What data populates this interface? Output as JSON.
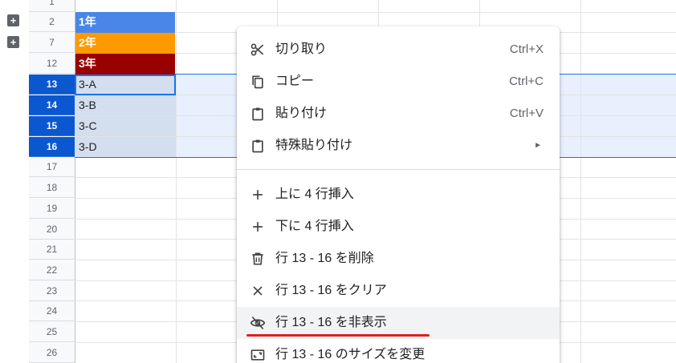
{
  "row_headers": [
    "1",
    "2",
    "7",
    "12",
    "13",
    "14",
    "15",
    "16",
    "17",
    "18",
    "19",
    "20",
    "21",
    "22",
    "23",
    "24",
    "25",
    "26"
  ],
  "cells": [
    {
      "text": "1年",
      "bg": "#4a86e8",
      "bold": true
    },
    {
      "text": "2年",
      "bg": "#ff9900",
      "bold": true
    },
    {
      "text": "3年",
      "bg": "#990000",
      "bold": true
    },
    {
      "text": "3-A",
      "bg": "",
      "bold": false
    },
    {
      "text": "3-B",
      "bg": "",
      "bold": false
    },
    {
      "text": "3-C",
      "bg": "",
      "bold": false
    },
    {
      "text": "3-D",
      "bg": "",
      "bold": false
    }
  ],
  "group_buttons": [
    "+",
    "+"
  ],
  "context_menu": {
    "items": [
      {
        "label": "切り取り",
        "shortcut": "Ctrl+X",
        "icon": "scissors-icon"
      },
      {
        "label": "コピー",
        "shortcut": "Ctrl+C",
        "icon": "copy-icon"
      },
      {
        "label": "貼り付け",
        "shortcut": "Ctrl+V",
        "icon": "clipboard-icon"
      },
      {
        "label": "特殊貼り付け",
        "submenu_arrow": "►",
        "icon": "clipboard-icon"
      },
      {
        "label": "上に 4 行挿入",
        "icon": "plus-icon"
      },
      {
        "label": "下に 4 行挿入",
        "icon": "plus-icon"
      },
      {
        "label": "行 13 - 16 を削除",
        "icon": "trash-icon"
      },
      {
        "label": "行 13 - 16 をクリア",
        "icon": "close-icon"
      },
      {
        "label": "行 13 - 16 を非表示",
        "icon": "eye-off-icon"
      },
      {
        "label": "行 13 - 16 のサイズを変更",
        "icon": "resize-icon"
      }
    ]
  },
  "colors": {
    "selection": "#0b57d0",
    "highlight": "#e02020"
  }
}
